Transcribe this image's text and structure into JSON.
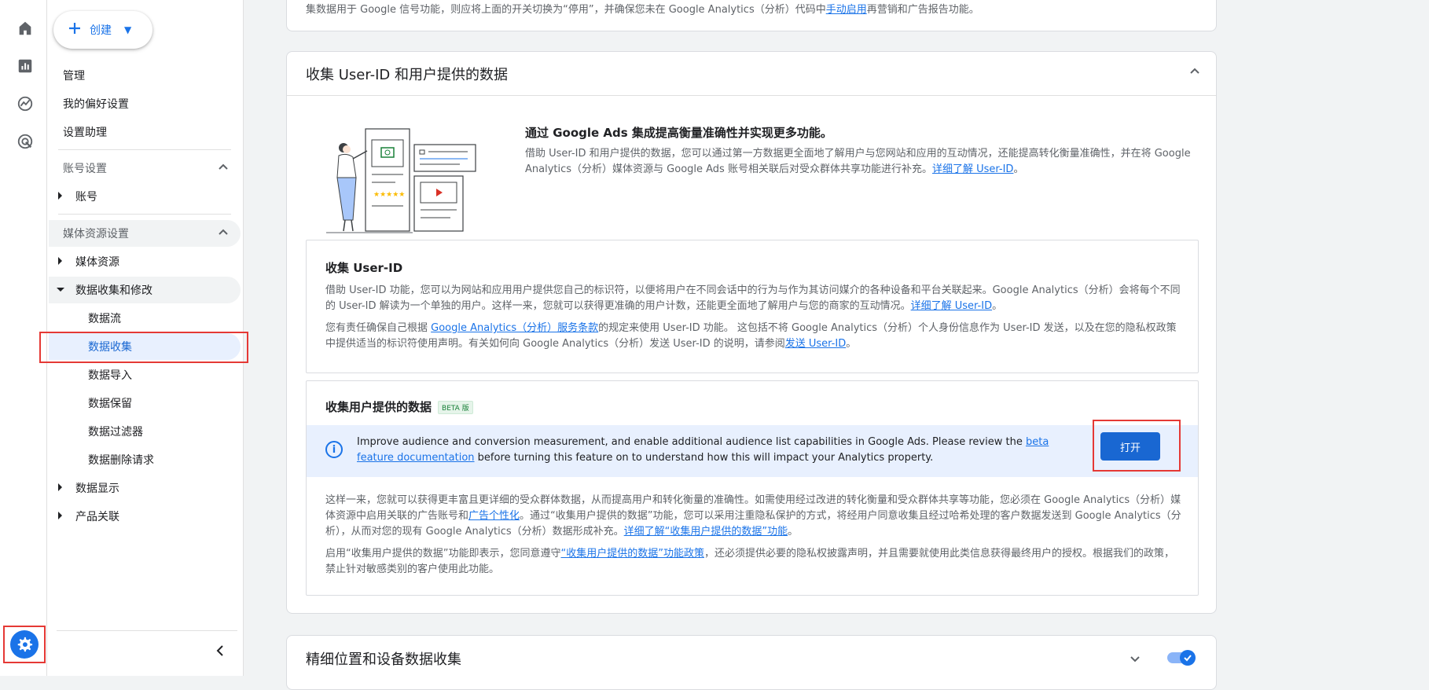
{
  "nav": {
    "create_label": "创建",
    "links": [
      "管理",
      "我的偏好设置",
      "设置助理"
    ],
    "account_section": "账号设置",
    "account_item": "账号",
    "property_section": "媒体资源设置",
    "property_item": "媒体资源",
    "data_collection_item": "数据收集和修改",
    "sub_items": [
      "数据流",
      "数据收集",
      "数据导入",
      "数据保留",
      "数据过滤器",
      "数据删除请求"
    ],
    "display_item": "数据显示",
    "product_item": "产品关联"
  },
  "top_card": {
    "text_before": "集数据用于 Google 信号功能，则应将上面的开关切换为“停用”，并确保您未在 Google Analytics（分析）代码中",
    "link": "手动启用",
    "text_after": "再营销和广告报告功能。"
  },
  "main_card": {
    "title": "收集 User-ID 和用户提供的数据",
    "intro_title": "通过 Google Ads 集成提高衡量准确性并实现更多功能。",
    "intro_text": "借助 User-ID 和用户提供的数据，您可以通过第一方数据更全面地了解用户与您网站和应用的互动情况，还能提高转化衡量准确性，并在将 Google Analytics（分析）媒体资源与 Google Ads 账号相关联后对受众群体共享功能进行补充。",
    "intro_link": "详细了解 User-ID",
    "intro_end": "。"
  },
  "userid": {
    "title": "收集 User-ID",
    "p1": "借助 User-ID 功能，您可以为网站和应用用户提供您自己的标识符，以便将用户在不同会话中的行为与作为其访问媒介的各种设备和平台关联起来。Google Analytics（分析）会将每个不同的 User-ID 解读为一个单独的用户。这样一来，您就可以获得更准确的用户计数，还能更全面地了解用户与您的商家的互动情况。",
    "p1_link": "详细了解 User-ID",
    "p1_end": "。",
    "p2_a": "您有责任确保自己根据 ",
    "p2_link1": "Google Analytics（分析）服务条款",
    "p2_b": "的规定来使用 User-ID 功能。 这包括不将 Google Analytics（分析）个人身份信息作为 User-ID 发送，以及在您的隐私权政策中提供适当的标识符使用声明。有关如何向 Google Analytics（分析）发送 User-ID 的说明，请参阅",
    "p2_link2": "发送 User-ID",
    "p2_end": "。"
  },
  "upd": {
    "title": "收集用户提供的数据",
    "beta": "BETA 版",
    "banner_a": "Improve audience and conversion measurement, and enable additional audience list capabilities in Google Ads. Please review the ",
    "banner_link": "beta feature documentation",
    "banner_b": " before turning this feature on to understand how this will impact your Analytics property.",
    "open_button": "打开",
    "p1_a": "这样一来，您就可以获得更丰富且更详细的受众群体数据，从而提高用户和转化衡量的准确性。如需使用经过改进的转化衡量和受众群体共享等功能，您必须在 Google Analytics（分析）媒体资源中启用关联的广告账号和",
    "p1_link1": "广告个性化",
    "p1_b": "。通过“收集用户提供的数据”功能，您可以采用注重隐私保护的方式，将经用户同意收集且经过哈希处理的客户数据发送到 Google Analytics（分析），从而对您的现有 Google Analytics（分析）数据形成补充。",
    "p1_link2": "详细了解“收集用户提供的数据”功能",
    "p1_end": "。",
    "p2_a": "启用“收集用户提供的数据”功能即表示，您同意遵守",
    "p2_link": "“收集用户提供的数据”功能政策",
    "p2_b": "，还必须提供必要的隐私权披露声明，并且需要就使用此类信息获得最终用户的授权。根据我们的政策，禁止针对敏感类别的客户使用此功能。"
  },
  "bottom_card": {
    "title": "精细位置和设备数据收集"
  },
  "colors": {
    "accent": "#1a73e8",
    "highlight": "#e53935",
    "active_bg": "#e8f0fe"
  }
}
